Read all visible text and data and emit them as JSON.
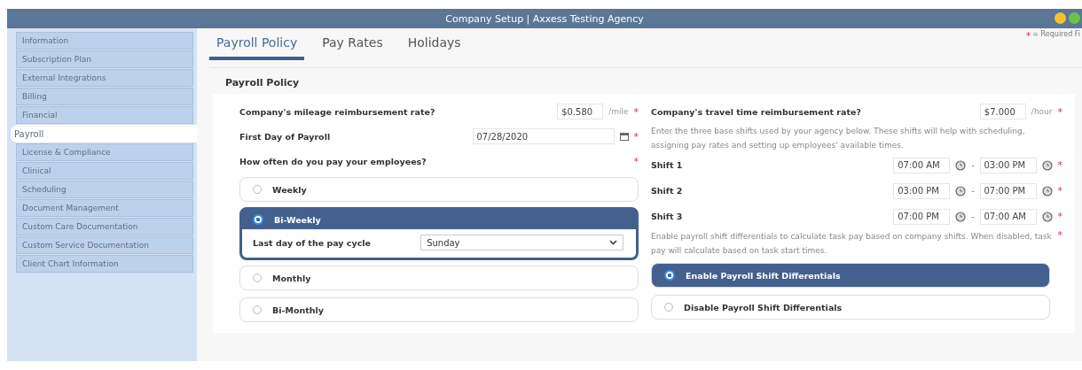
{
  "window": {
    "title": "Company Setup | Axxess Testing Agency"
  },
  "sidebar": {
    "items": [
      {
        "label": "Information",
        "selected": false
      },
      {
        "label": "Subscription Plan",
        "selected": false
      },
      {
        "label": "External Integrations",
        "selected": false
      },
      {
        "label": "Billing",
        "selected": false
      },
      {
        "label": "Financial",
        "selected": false
      },
      {
        "label": "Payroll",
        "selected": true
      },
      {
        "label": "License & Compliance",
        "selected": false
      },
      {
        "label": "Clinical",
        "selected": false
      },
      {
        "label": "Scheduling",
        "selected": false
      },
      {
        "label": "Document Management",
        "selected": false
      },
      {
        "label": "Custom Care Documentation",
        "selected": false
      },
      {
        "label": "Custom Service Documentation",
        "selected": false
      },
      {
        "label": "Client Chart Information",
        "selected": false
      }
    ]
  },
  "tabs": [
    {
      "label": "Payroll Policy",
      "selected": true
    },
    {
      "label": "Pay Rates",
      "selected": false
    },
    {
      "label": "Holidays",
      "selected": false
    }
  ],
  "required_note": {
    "mark": "*",
    "text": "= Required Fi"
  },
  "section": {
    "title": "Payroll Policy",
    "mileage": {
      "label": "Company's mileage reimbursement rate?",
      "value": "$0.580",
      "unit": "/mile",
      "mark": "*"
    },
    "first_day": {
      "label": "First Day of Payroll",
      "value": "07/28/2020",
      "mark": "*"
    },
    "frequency": {
      "label": "How often do you pay your employees?",
      "mark": "*",
      "options": [
        {
          "label": "Weekly",
          "selected": false
        },
        {
          "label": "Bi-Weekly",
          "selected": true,
          "detail": {
            "label": "Last day of the pay cycle",
            "value": "Sunday"
          }
        },
        {
          "label": "Monthly",
          "selected": false
        },
        {
          "label": "Bi-Monthly",
          "selected": false
        }
      ]
    },
    "travel": {
      "label": "Company's travel time reimbursement rate?",
      "value": "$7.000",
      "unit": "/hour",
      "mark": "*"
    },
    "shifts_note": {
      "text": "Enter the three base shifts used by your agency below. These shifts will help with scheduling, assigning pay rates and setting up employees' available times."
    },
    "shifts": [
      {
        "label": "Shift 1",
        "start": "07:00 AM",
        "sep": "-",
        "end": "03:00 PM",
        "mark": "*"
      },
      {
        "label": "Shift 2",
        "start": "03:00 PM",
        "sep": "-",
        "end": "07:00 PM",
        "mark": "*"
      },
      {
        "label": "Shift 3",
        "start": "07:00 PM",
        "sep": "-",
        "end": "07:00 AM",
        "mark": "*"
      }
    ],
    "differentials": {
      "text": "Enable payroll shift differentials to calculate task pay based on company shifts. When disabled, task pay will calculate based on task start times.",
      "mark": "*",
      "options": [
        {
          "label": "Enable Payroll Shift Differentials",
          "selected": true
        },
        {
          "label": "Disable Payroll Shift Differentials",
          "selected": false
        }
      ]
    }
  }
}
